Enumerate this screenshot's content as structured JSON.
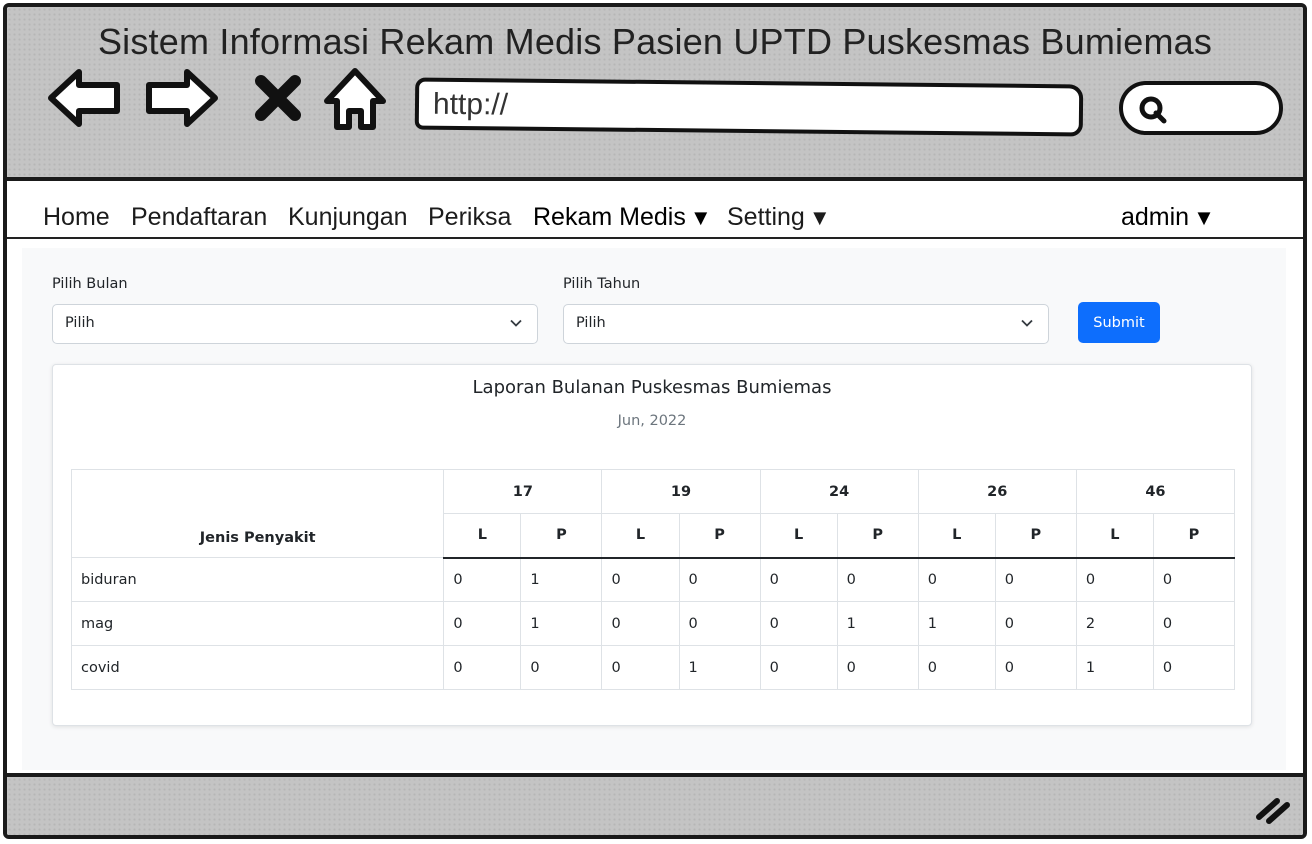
{
  "window": {
    "title": "Sistem Informasi Rekam Medis Pasien UPTD Puskesmas Bumiemas",
    "url": "http://"
  },
  "menu": {
    "items": [
      {
        "label": "Home"
      },
      {
        "label": "Pendaftaran"
      },
      {
        "label": "Kunjungan"
      },
      {
        "label": "Periksa"
      },
      {
        "label": "Rekam Medis",
        "caret": "▼"
      },
      {
        "label": "Setting",
        "caret": "▼"
      }
    ],
    "user": {
      "label": "admin",
      "caret": "▼"
    }
  },
  "filters": {
    "month_label": "Pilih Bulan",
    "month_value": "Pilih",
    "year_label": "Pilih Tahun",
    "year_value": "Pilih",
    "submit_label": "Submit",
    "submit_color": "#0d6efd"
  },
  "report": {
    "title": "Laporan Bulanan Puskesmas Bumiemas",
    "subtitle": "Jun, 2022",
    "disease_header": "Jenis Penyakit",
    "groups": [
      "17",
      "19",
      "24",
      "26",
      "46"
    ],
    "sub_headers": [
      "L",
      "P"
    ],
    "rows": [
      {
        "name": "biduran",
        "values": [
          "0",
          "1",
          "0",
          "0",
          "0",
          "0",
          "0",
          "0",
          "0",
          "0"
        ]
      },
      {
        "name": "mag",
        "values": [
          "0",
          "1",
          "0",
          "0",
          "0",
          "1",
          "1",
          "0",
          "2",
          "0"
        ]
      },
      {
        "name": "covid",
        "values": [
          "0",
          "0",
          "0",
          "1",
          "0",
          "0",
          "0",
          "0",
          "1",
          "0"
        ]
      }
    ]
  }
}
